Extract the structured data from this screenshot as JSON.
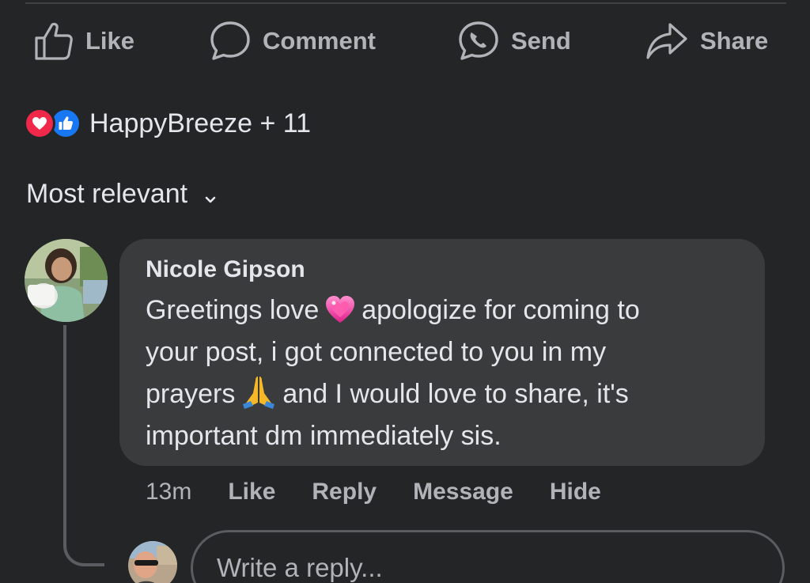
{
  "actions": {
    "like_label": "Like",
    "comment_label": "Comment",
    "send_label": "Send",
    "share_label": "Share"
  },
  "reactions": {
    "icons": [
      "love-icon",
      "like-icon"
    ],
    "summary": "HappyBreeze + 11"
  },
  "sort": {
    "label": "Most relevant"
  },
  "comment": {
    "author": "Nicole Gipson",
    "lines": [
      {
        "before": "Greetings love",
        "emoji": "💗",
        "after": "apologize for coming to"
      },
      {
        "text": "your post, i got connected to you in my"
      },
      {
        "before": "prayers",
        "emoji": "🙏",
        "after": "and I would love to share, it's"
      },
      {
        "text": "important dm immediately sis."
      }
    ],
    "time": "13m",
    "like_label": "Like",
    "reply_label": "Reply",
    "message_label": "Message",
    "hide_label": "Hide"
  },
  "reply": {
    "placeholder": "Write a reply..."
  },
  "colors": {
    "background": "#242526",
    "bubble": "#3a3b3c",
    "text_primary": "#e4e6eb",
    "text_secondary": "#b0b3b8",
    "love_red": "#f02849",
    "like_blue": "#1877f2"
  }
}
